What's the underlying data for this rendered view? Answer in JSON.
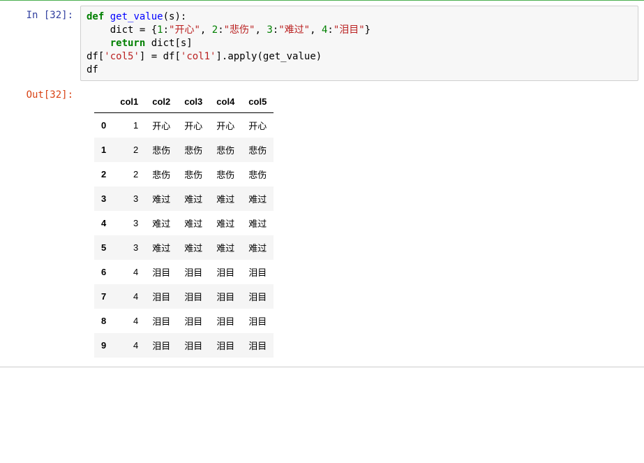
{
  "input": {
    "prompt": "In  [32]:",
    "code": {
      "def": "def",
      "get_value": "get_value",
      "s": "(s):",
      "dict_assign": "dict",
      "equals": " = {",
      "n1": "1",
      "c1": ":",
      "s1": "\"开心\"",
      "cm1": ", ",
      "n2": "2",
      "c2": ":",
      "s2": "\"悲伤\"",
      "cm2": ", ",
      "n3": "3",
      "c3": ":",
      "s3": "\"难过\"",
      "cm3": ", ",
      "n4": "4",
      "c4": ":",
      "s4": "\"泪目\"",
      "close": "}",
      "return": "return",
      "dictsub": " dict[s]",
      "df": "df[",
      "col5": "'col5'",
      "mid": "] = df[",
      "col1": "'col1'",
      "apply": "].apply(get_value)",
      "last": "df"
    }
  },
  "output": {
    "prompt": "Out[32]:",
    "table": {
      "columns": [
        "col1",
        "col2",
        "col3",
        "col4",
        "col5"
      ],
      "rows": [
        {
          "idx": "0",
          "cells": [
            "1",
            "开心",
            "开心",
            "开心",
            "开心"
          ]
        },
        {
          "idx": "1",
          "cells": [
            "2",
            "悲伤",
            "悲伤",
            "悲伤",
            "悲伤"
          ]
        },
        {
          "idx": "2",
          "cells": [
            "2",
            "悲伤",
            "悲伤",
            "悲伤",
            "悲伤"
          ]
        },
        {
          "idx": "3",
          "cells": [
            "3",
            "难过",
            "难过",
            "难过",
            "难过"
          ]
        },
        {
          "idx": "4",
          "cells": [
            "3",
            "难过",
            "难过",
            "难过",
            "难过"
          ]
        },
        {
          "idx": "5",
          "cells": [
            "3",
            "难过",
            "难过",
            "难过",
            "难过"
          ]
        },
        {
          "idx": "6",
          "cells": [
            "4",
            "泪目",
            "泪目",
            "泪目",
            "泪目"
          ]
        },
        {
          "idx": "7",
          "cells": [
            "4",
            "泪目",
            "泪目",
            "泪目",
            "泪目"
          ]
        },
        {
          "idx": "8",
          "cells": [
            "4",
            "泪目",
            "泪目",
            "泪目",
            "泪目"
          ]
        },
        {
          "idx": "9",
          "cells": [
            "4",
            "泪目",
            "泪目",
            "泪目",
            "泪目"
          ]
        }
      ]
    }
  }
}
